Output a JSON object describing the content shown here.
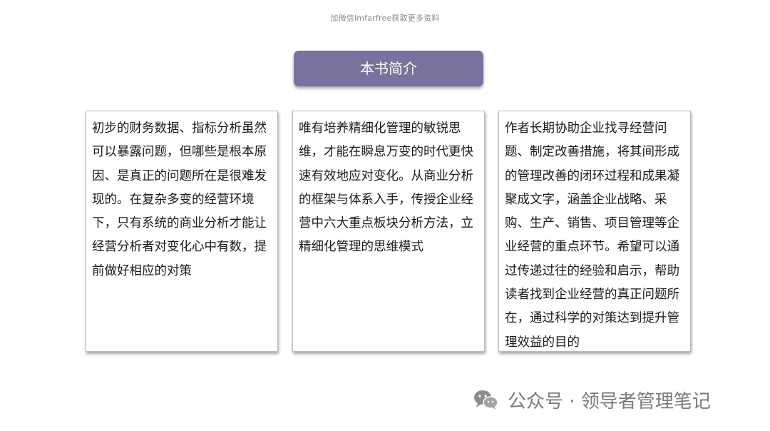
{
  "header": {
    "note": "加微信lmfarfree获取更多资料"
  },
  "title": {
    "label": "本书简介"
  },
  "cards": [
    {
      "text": "初步的财务数据、指标分析虽然可以暴露问题，但哪些是根本原因、是真正的问题所在是很难发现的。在复杂多变的经营环境下，只有系统的商业分析才能让经营分析者对变化心中有数，提前做好相应的对策"
    },
    {
      "text": "唯有培养精细化管理的敏锐思维，才能在瞬息万变的时代更快速有效地应对变化。从商业分析的框架与体系入手，传授企业经营中六大重点板块分析方法，立精细化管理的思维模式"
    },
    {
      "text": "作者长期协助企业找寻经营问题、制定改善措施，将其间形成的管理改善的闭环过程和成果凝聚成文字，涵盖企业战略、采购、生产、销售、项目管理等企业经营的重点环节。希望可以通过传递过往的经验和启示，帮助读者找到企业经营的真正问题所在，通过科学的对策达到提升管理效益的目的"
    }
  ],
  "footer": {
    "icon": "wechat-icon",
    "label": "公众号 · 领导者管理笔记"
  },
  "colors": {
    "title_badge": "#7b719e",
    "card_border": "#b9b9b9",
    "footer_text": "#7a7a7a"
  }
}
